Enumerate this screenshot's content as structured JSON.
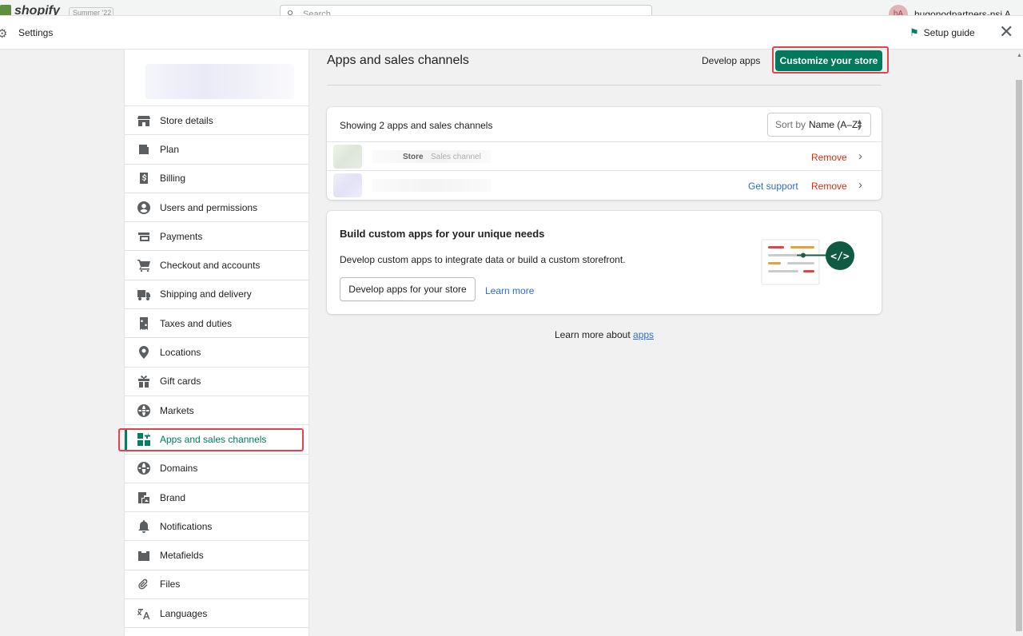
{
  "topbar": {
    "logo_text": "shopify",
    "badge_text": "Summer '22",
    "search_placeholder": "Search",
    "user_initials": "hA",
    "user_name": "hugonodpartners-nsi A"
  },
  "header": {
    "title": "Settings",
    "setup_guide": "Setup guide",
    "close_icon": "close-icon"
  },
  "sidebar": {
    "items": [
      {
        "label": "Store details",
        "icon": "store-icon"
      },
      {
        "label": "Plan",
        "icon": "plan-icon"
      },
      {
        "label": "Billing",
        "icon": "billing-icon"
      },
      {
        "label": "Users and permissions",
        "icon": "user-icon"
      },
      {
        "label": "Payments",
        "icon": "payments-icon"
      },
      {
        "label": "Checkout and accounts",
        "icon": "cart-icon"
      },
      {
        "label": "Shipping and delivery",
        "icon": "truck-icon"
      },
      {
        "label": "Taxes and duties",
        "icon": "tax-icon"
      },
      {
        "label": "Locations",
        "icon": "location-icon"
      },
      {
        "label": "Gift cards",
        "icon": "gift-icon"
      },
      {
        "label": "Markets",
        "icon": "globe-icon"
      },
      {
        "label": "Apps and sales channels",
        "icon": "apps-icon",
        "active": true
      },
      {
        "label": "Domains",
        "icon": "domain-icon"
      },
      {
        "label": "Brand",
        "icon": "brand-icon"
      },
      {
        "label": "Notifications",
        "icon": "bell-icon"
      },
      {
        "label": "Metafields",
        "icon": "metafields-icon"
      },
      {
        "label": "Files",
        "icon": "paperclip-icon"
      },
      {
        "label": "Languages",
        "icon": "language-icon"
      }
    ]
  },
  "main": {
    "title": "Apps and sales channels",
    "develop_apps": "Develop apps",
    "customize_store": "Customize your store",
    "apps_card": {
      "count_text": "Showing 2 apps and sales channels",
      "sort_label": "Sort by",
      "sort_value": "Name (A–Z)",
      "rows": [
        {
          "name": "Store",
          "type": "Sales channel",
          "support": "",
          "remove": "Remove"
        },
        {
          "name": "",
          "type": "",
          "support": "Get support",
          "remove": "Remove"
        }
      ]
    },
    "build_card": {
      "title": "Build custom apps for your unique needs",
      "body": "Develop custom apps to integrate data or build a custom storefront.",
      "button": "Develop apps for your store",
      "link": "Learn more"
    },
    "footer": {
      "text": "Learn more about",
      "link": "apps"
    }
  },
  "colors": {
    "primary": "#007a5c",
    "highlight": "#e0434e",
    "link": "#2c6ecb",
    "critical": "#d72c0d"
  }
}
